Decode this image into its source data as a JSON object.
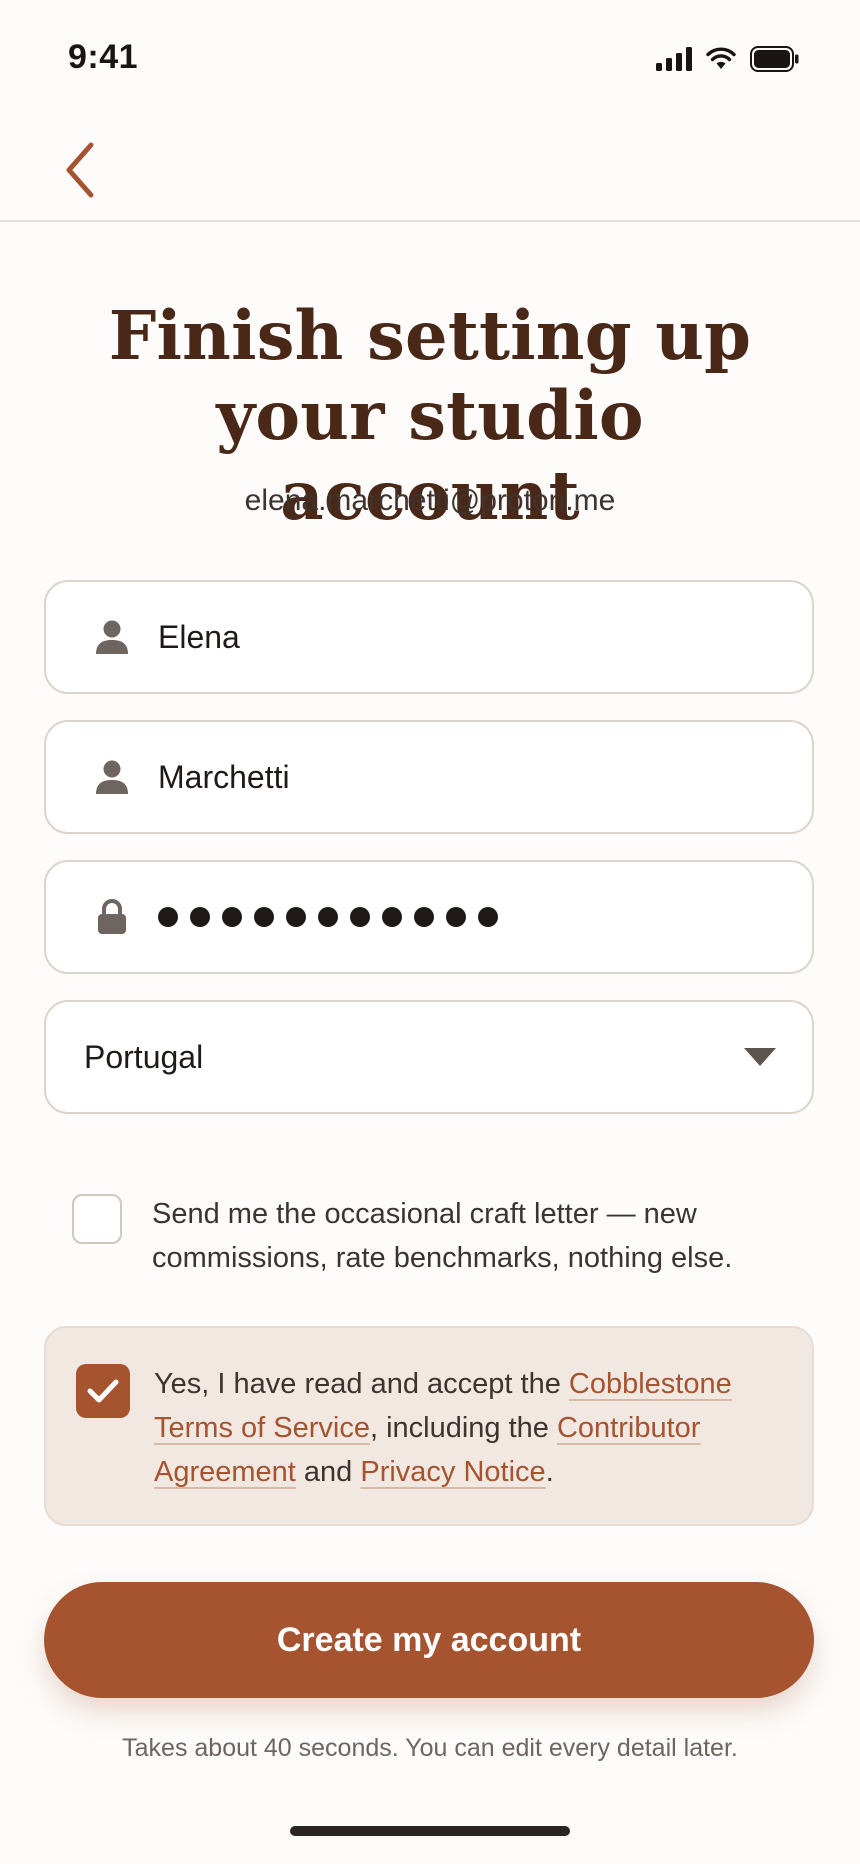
{
  "status_bar": {
    "time": "9:41"
  },
  "header": {
    "title": "Finish setting up your studio account",
    "email": "elena.marchetti@proton.me"
  },
  "form": {
    "first_name": {
      "value": "Elena",
      "icon": "person-icon"
    },
    "last_name": {
      "value": "Marchetti",
      "icon": "person-icon"
    },
    "password": {
      "masked_length": 11,
      "icon": "lock-icon"
    },
    "country": {
      "value": "Portugal"
    },
    "newsletter": {
      "checked": false,
      "label": "Send me the occasional craft letter — new commissions, rate benchmarks, nothing else."
    },
    "terms": {
      "checked": true,
      "prefix": "Yes, I have read and accept the ",
      "tos_link": "Cobblestone Terms of Service",
      "middle1": ", including the ",
      "contributor_link": "Contributor Agreement",
      "middle2": " and ",
      "privacy_link": "Privacy Notice",
      "suffix": "."
    }
  },
  "cta": {
    "label": "Create my account"
  },
  "footnote": "Takes about 40 seconds. You can edit every detail later.",
  "colors": {
    "accent": "#a65330",
    "title": "#4a2818",
    "terms_bg": "#f1e8e1",
    "background": "#fdfcfa"
  }
}
